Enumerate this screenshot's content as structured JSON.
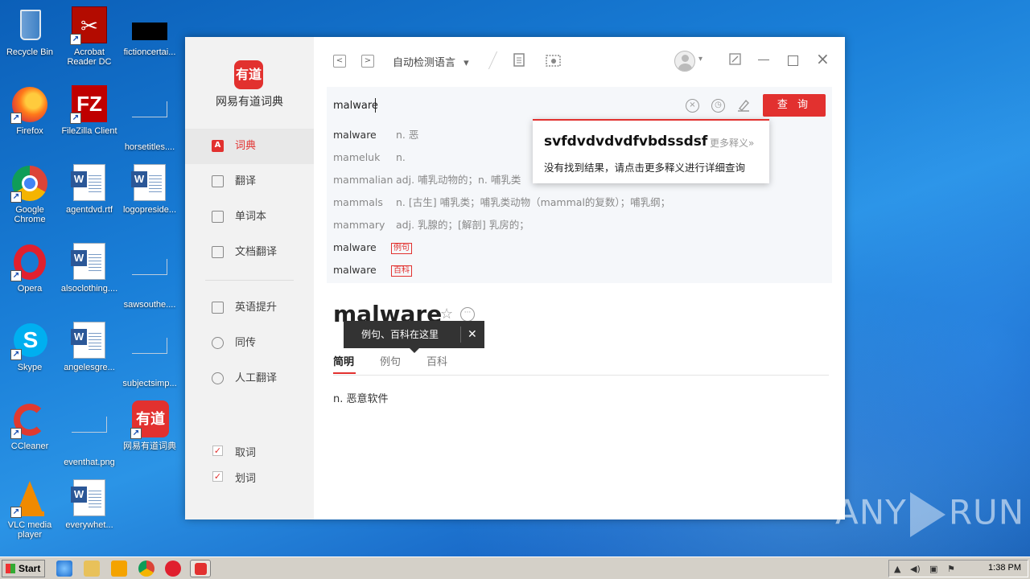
{
  "desktop": {
    "icons": [
      {
        "label": "Recycle Bin"
      },
      {
        "label": "Acrobat Reader DC"
      },
      {
        "label": "fictioncertai..."
      },
      {
        "label": "Firefox"
      },
      {
        "label": "FileZilla Client"
      },
      {
        "label": "horsetitles...."
      },
      {
        "label": "Google Chrome"
      },
      {
        "label": "agentdvd.rtf"
      },
      {
        "label": "logopreside..."
      },
      {
        "label": "Opera"
      },
      {
        "label": "alsoclothing...."
      },
      {
        "label": "sawsouthe...."
      },
      {
        "label": "Skype"
      },
      {
        "label": "angelesgre..."
      },
      {
        "label": "subjectsimp..."
      },
      {
        "label": "CCleaner"
      },
      {
        "label": "eventhat.png"
      },
      {
        "label": "网易有道词典"
      },
      {
        "label": "VLC media player"
      },
      {
        "label": "everywhet..."
      }
    ]
  },
  "app": {
    "logo_mark": "有道",
    "logo_text": "网易有道词典",
    "nav": [
      {
        "label": "词典",
        "icon": "A"
      },
      {
        "label": "翻译"
      },
      {
        "label": "单词本"
      },
      {
        "label": "文档翻译"
      },
      {
        "label": "英语提升"
      },
      {
        "label": "同传"
      },
      {
        "label": "人工翻译"
      }
    ],
    "checks": [
      {
        "label": "取词",
        "checked": true
      },
      {
        "label": "划词",
        "checked": true
      }
    ],
    "toolbar": {
      "back": "<",
      "forward": ">",
      "language": "自动检测语言",
      "language_arrow": "▾"
    },
    "search": {
      "value": "malware",
      "query_label": "查 询"
    },
    "suggestions": [
      {
        "word": "malware",
        "meaning": "n. 恶"
      },
      {
        "word": "mameluk",
        "meaning": "n."
      },
      {
        "word": "mammalian",
        "meaning": "adj. 哺乳动物的；n. 哺乳类"
      },
      {
        "word": "mammals",
        "meaning": "n. [古生] 哺乳类；哺乳类动物（mammal的复数）；哺乳纲；"
      },
      {
        "word": "mammary",
        "meaning": "adj. 乳腺的；[解剖] 乳房的；"
      },
      {
        "word": "malware",
        "tag": "例句"
      },
      {
        "word": "malware",
        "tag": "百科"
      }
    ],
    "popup": {
      "word": "svfdvdvdvdfvbdssdsf",
      "more": "更多释义»",
      "message": "没有找到结果，请点击更多释义进行详细查询"
    },
    "result": {
      "word": "malware",
      "tooltip": "例句、百科在这里",
      "tabs": [
        "简明",
        "例句",
        "百科"
      ],
      "definition": "n. 恶意软件"
    }
  },
  "watermark": {
    "left": "ANY",
    "right": "RUN"
  },
  "taskbar": {
    "start": "Start",
    "clock": "1:38 PM"
  }
}
